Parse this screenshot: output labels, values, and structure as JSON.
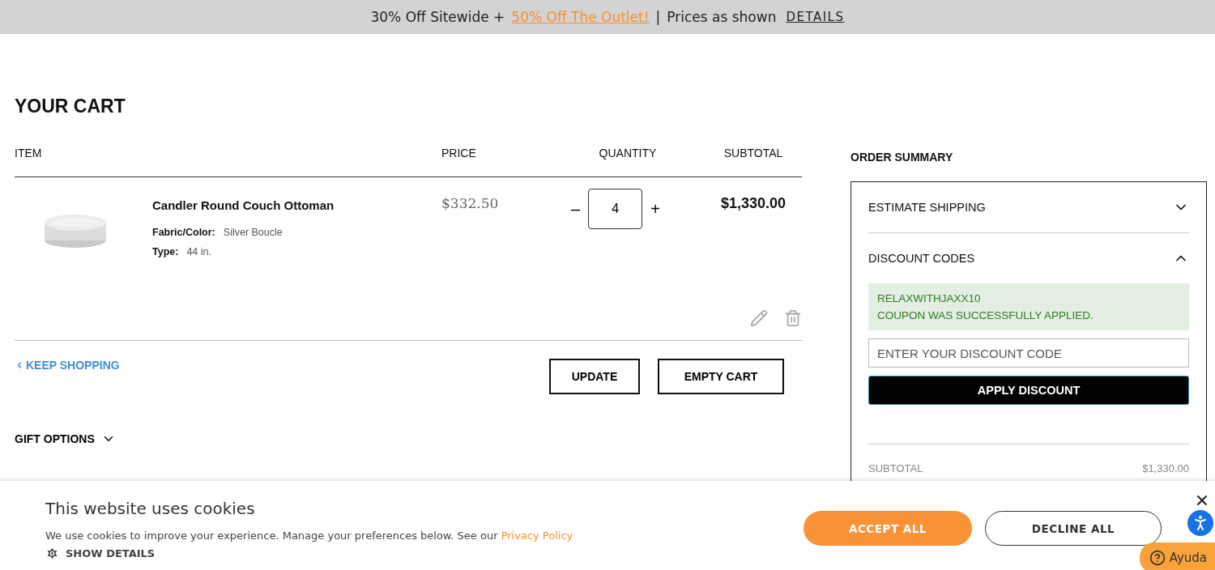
{
  "promo_bar": {
    "text_before": "30% Off Sitewide +",
    "link": "50% Off The Outlet!",
    "separator": "|",
    "text_after": "Prices as shown",
    "details_link": "DETAILS"
  },
  "page_title": "YOUR CART",
  "table": {
    "columns": [
      "ITEM",
      "PRICE",
      "QUANTITY",
      "SUBTOTAL"
    ],
    "rows": [
      {
        "name": "Candler Round Couch Ottoman",
        "options": [
          {
            "label": "Fabric/Color:",
            "value": "Silver Boucle"
          },
          {
            "label": "Type:",
            "value": "44 in."
          }
        ],
        "price": "$332.50",
        "decrement": "–",
        "quantity": "4",
        "increment": "+",
        "subtotal": "$1,330.00"
      }
    ]
  },
  "keep_shopping": "KEEP SHOPPING",
  "buttons": [
    "UPDATE",
    "EMPTY CART"
  ],
  "gift_options": {
    "label": "GIFT OPTIONS",
    "expanded": false
  },
  "order_summary": {
    "title": "ORDER SUMMARY",
    "sections": [
      {
        "label": "ESTIMATE SHIPPING",
        "expanded": false
      },
      {
        "label": "DISCOUNT CODES",
        "expanded": true,
        "coupon_code": "RELAXWITHJAXX10",
        "coupon_message": "COUPON WAS SUCCESSFULLY APPLIED.",
        "field_placeholder": "ENTER YOUR DISCOUNT CODE",
        "apply_button": "APPLY DISCOUNT"
      }
    ],
    "totals": [
      {
        "label": "SUBTOTAL",
        "value": "$1,330.00"
      }
    ]
  },
  "cookie_banner": {
    "title": "This website uses cookies",
    "text": "We use cookies to improve your experience. Manage your preferences below. See our",
    "link": "Privacy Policy",
    "show_details": "SHOW DETAILS",
    "accept": "ACCEPT ALL",
    "decline": "DECLINE ALL"
  },
  "help_button": "Ayuda"
}
